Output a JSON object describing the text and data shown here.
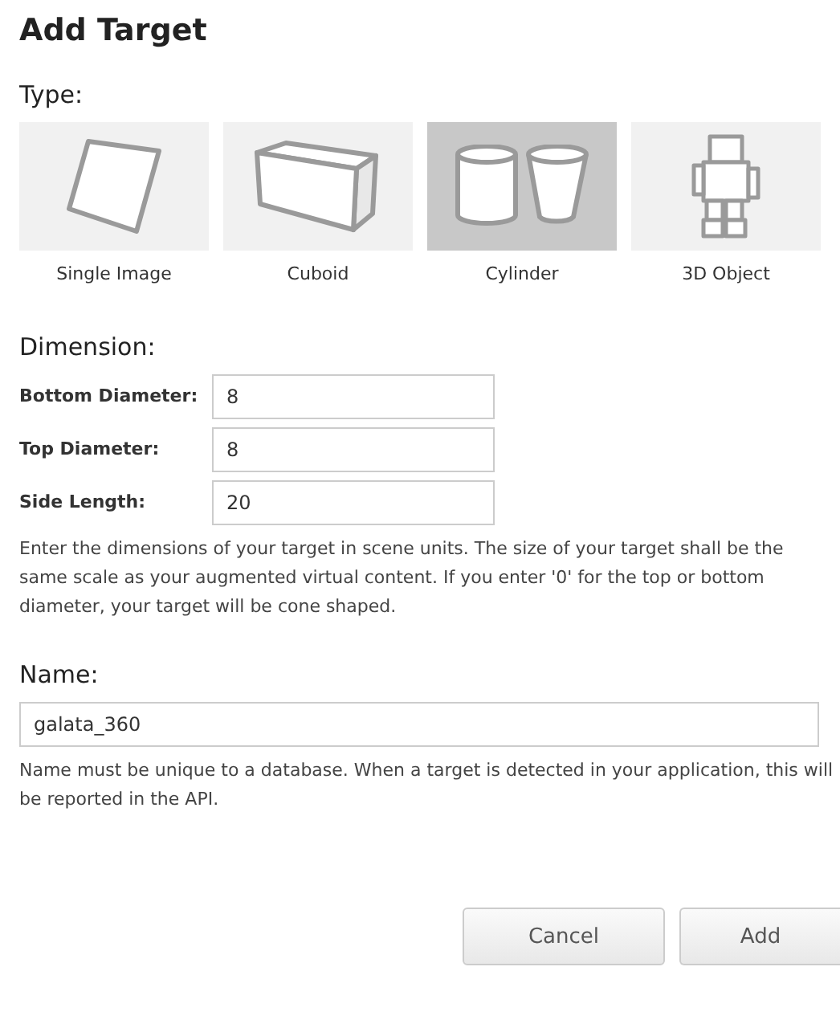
{
  "title": "Add Target",
  "type_section": {
    "heading": "Type:",
    "options": [
      {
        "kind": "image",
        "label": "Single Image",
        "selected": false
      },
      {
        "kind": "cuboid",
        "label": "Cuboid",
        "selected": false
      },
      {
        "kind": "cylinder",
        "label": "Cylinder",
        "selected": true
      },
      {
        "kind": "object",
        "label": "3D Object",
        "selected": false
      }
    ]
  },
  "dimension_section": {
    "heading": "Dimension:",
    "fields": [
      {
        "label": "Bottom Diameter:",
        "value": "8"
      },
      {
        "label": "Top Diameter:",
        "value": "8"
      },
      {
        "label": "Side Length:",
        "value": "20"
      }
    ],
    "help": "Enter the dimensions of your target in scene units. The size of your target shall be the same scale as your augmented virtual content. If you enter '0' for the top or bottom diameter, your target will be cone shaped."
  },
  "name_section": {
    "heading": "Name:",
    "value": "galata_360",
    "help": "Name must be unique to a database. When a target is detected in your application, this will be reported in the API."
  },
  "buttons": [
    "Cancel",
    "Add"
  ]
}
